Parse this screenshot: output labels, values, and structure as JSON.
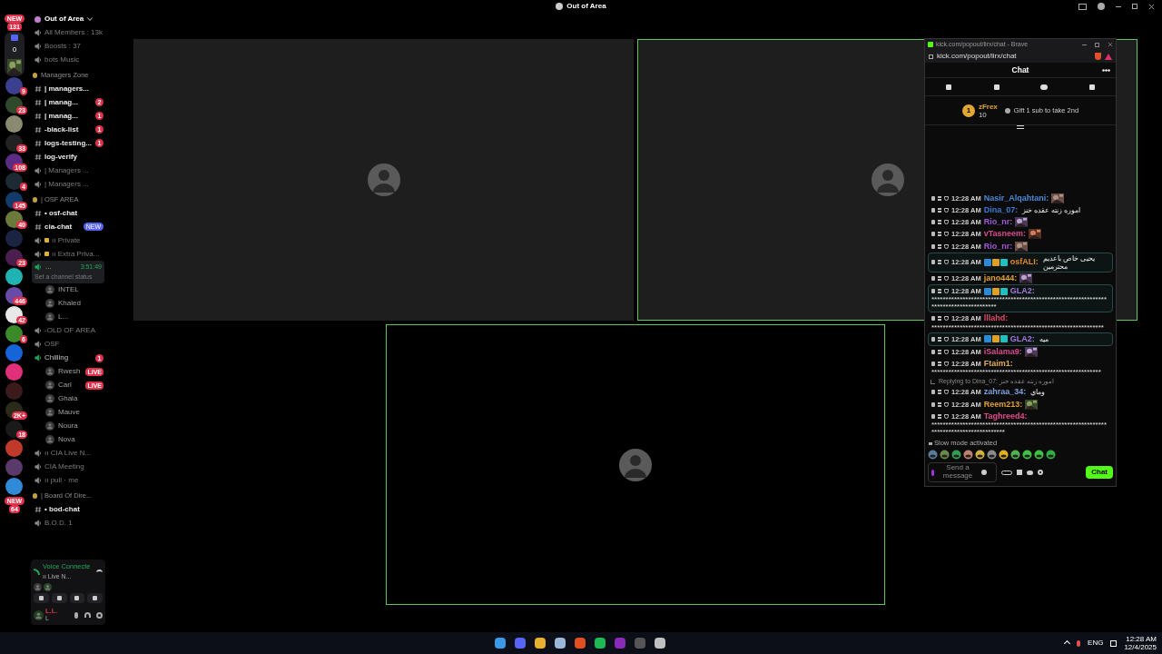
{
  "topbar": {
    "title": "Out of Area"
  },
  "servers": [
    {
      "color": "#3b3f8f",
      "badge": "9"
    },
    {
      "color": "#2f4a2a",
      "badge": "23"
    },
    {
      "color": "#8a8a70"
    },
    {
      "color": "#222222",
      "badge": "33"
    },
    {
      "color": "#5b2c83",
      "badge": "108"
    },
    {
      "color": "#1d2a33",
      "badge": "4"
    },
    {
      "color": "#123a6a",
      "badge": "145"
    },
    {
      "color": "#6b7a3a",
      "badge": "40"
    },
    {
      "color": "#1a2440"
    },
    {
      "color": "#4a1f4f",
      "badge": "23"
    },
    {
      "color": "#1fb3b3"
    },
    {
      "color": "#6a4aa8",
      "badge": "446"
    },
    {
      "color": "#e8e8e8",
      "badge": "42"
    },
    {
      "color": "#3a8a2a",
      "badge": "6"
    },
    {
      "color": "#1565d8"
    },
    {
      "color": "#e0307a"
    },
    {
      "color": "#3a1a1a"
    },
    {
      "color": "#2a2a1a",
      "badge": "2K+"
    },
    {
      "color": "#1a1a1a",
      "badge": "18"
    },
    {
      "color": "#c0392b"
    },
    {
      "color": "#5a3a6a"
    },
    {
      "color": "#2f8ad8"
    }
  ],
  "server_top_badge": {
    "tag": "NEW",
    "count": "131"
  },
  "server_folder": {
    "count": "0"
  },
  "server_bottom_badge": {
    "tag": "NEW",
    "count": "64"
  },
  "server_name": "Out of Area",
  "channels": [
    {
      "kind": "voice",
      "label": "All Members : 13k",
      "unread": false
    },
    {
      "kind": "voice",
      "label": "Boosts : 37",
      "unread": false
    },
    {
      "kind": "voice",
      "label": "bots Music",
      "unread": false
    },
    {
      "kind": "category",
      "label": "Managers Zone"
    },
    {
      "kind": "text",
      "label": "| managers...",
      "unread": true
    },
    {
      "kind": "text",
      "label": "| manag...",
      "unread": true,
      "badge": "2"
    },
    {
      "kind": "text",
      "label": "| manag...",
      "unread": true,
      "badge": "1"
    },
    {
      "kind": "text",
      "label": "-black-list",
      "unread": true,
      "badge": "1"
    },
    {
      "kind": "text",
      "label": "logs-testing...",
      "unread": true,
      "badge": "1"
    },
    {
      "kind": "text",
      "label": "log-verify",
      "unread": true
    },
    {
      "kind": "voice",
      "label": "| Managers ...",
      "unread": false
    },
    {
      "kind": "voice",
      "label": "| Managers ...",
      "unread": false
    },
    {
      "kind": "category",
      "label": "| OSF AREA"
    },
    {
      "kind": "text",
      "label": "• osf-chat",
      "unread": true
    },
    {
      "kind": "text",
      "label": "cia-chat",
      "unread": true,
      "tag": "NEW"
    },
    {
      "kind": "voice",
      "label": "ıı Private",
      "unread": false,
      "locked": true
    },
    {
      "kind": "voice",
      "label": "ıı Extra Priva...",
      "unread": false,
      "locked": true
    },
    {
      "kind": "active",
      "label": "...",
      "time": "3:51:49",
      "status": "Set a channel status"
    },
    {
      "kind": "member",
      "label": "INTEL"
    },
    {
      "kind": "member",
      "label": "Khaled"
    },
    {
      "kind": "member",
      "label": "L..."
    },
    {
      "kind": "voice",
      "label": "-OLD OF AREA",
      "unread": false
    },
    {
      "kind": "voice",
      "label": "OSF",
      "unread": false
    },
    {
      "kind": "voice",
      "label": "Chilling",
      "unread": false,
      "badge": "1",
      "connected": true
    },
    {
      "kind": "member",
      "label": "Rwesh",
      "live": "LIVE"
    },
    {
      "kind": "member",
      "label": "Carl",
      "live": "LIVE"
    },
    {
      "kind": "member",
      "label": "Ghala"
    },
    {
      "kind": "member",
      "label": "Mauve"
    },
    {
      "kind": "member",
      "label": "Noura"
    },
    {
      "kind": "member",
      "label": "Nova"
    },
    {
      "kind": "voice",
      "label": "ıı CIA Live N...",
      "unread": false
    },
    {
      "kind": "voice",
      "label": "CIA Meeting",
      "unread": false
    },
    {
      "kind": "voice",
      "label": "ıı pull · me",
      "unread": false
    },
    {
      "kind": "category",
      "label": "| Board Of Dire..."
    },
    {
      "kind": "text",
      "label": "• bod-chat",
      "unread": true
    },
    {
      "kind": "voice",
      "label": "B.O.D. 1",
      "unread": false
    }
  ],
  "voice_panel": {
    "status": "Voice Connecte",
    "channel": "ıı Live N..."
  },
  "user_panel": {
    "name": "L.L.",
    "sub": "L"
  },
  "chat": {
    "window_title": "kick.com/popout/lirx/chat - Brave",
    "url": "kick.com/popout/lirx/chat",
    "header": "Chat",
    "leader": {
      "rank": "1",
      "name": "zFrex",
      "points": "10",
      "gift": "Gift 1 sub to take 2nd"
    },
    "messages": [
      {
        "time": "12:28 AM",
        "user": "Nasir_Alqahtani:",
        "color": "#4a8ad8",
        "badged": false,
        "highlighted": false,
        "emote": true
      },
      {
        "time": "12:28 AM",
        "user": "Dina_07:",
        "color": "#3a7ad8",
        "badged": false,
        "highlighted": false,
        "emote": false,
        "text": "اموره زنته عقده خنز"
      },
      {
        "time": "12:28 AM",
        "user": "Rio_nr:",
        "color": "#a05ad8",
        "badged": false,
        "highlighted": false,
        "emote": true
      },
      {
        "time": "12:28 AM",
        "user": "vTasneem:",
        "color": "#d84a8a",
        "badged": false,
        "highlighted": false,
        "emote": true
      },
      {
        "time": "12:28 AM",
        "user": "Rio_nr:",
        "color": "#a05ad8",
        "badged": false,
        "highlighted": false,
        "emote": true
      },
      {
        "time": "12:28 AM",
        "user": "osfALI:",
        "color": "#e08a20",
        "badged": true,
        "highlighted": true,
        "emote": false,
        "text": "يحيى خاص باعديم محترمين"
      },
      {
        "time": "12:28 AM",
        "user": "jano444:",
        "color": "#e0a030",
        "badged": false,
        "highlighted": false,
        "emote": true
      },
      {
        "time": "12:28 AM",
        "user": "GLA2:",
        "color": "#a07ae0",
        "badged": true,
        "highlighted": true,
        "emote": false,
        "text": "*************************************************************************************"
      },
      {
        "time": "12:28 AM",
        "user": "lllahd:",
        "color": "#e04a6a",
        "badged": false,
        "highlighted": false,
        "emote": false,
        "text": "*************************************************************"
      },
      {
        "time": "12:28 AM",
        "user": "GLA2:",
        "color": "#a07ae0",
        "badged": true,
        "highlighted": true,
        "emote": false,
        "text": "ميه"
      },
      {
        "time": "12:28 AM",
        "user": "iSalama9:",
        "color": "#d84a8a",
        "badged": false,
        "highlighted": false,
        "emote": true
      },
      {
        "time": "12:28 AM",
        "user": "Ftaim1:",
        "color": "#e0b040",
        "badged": false,
        "highlighted": false,
        "emote": false,
        "text": "************************************************************"
      },
      {
        "time": "12:28 AM",
        "user": "zahraa_34:",
        "color": "#7aa0d8",
        "badged": false,
        "highlighted": false,
        "emote": false,
        "text": "وماي",
        "reply": "Replying to Dina_07: اموره زنته عقده خنز"
      },
      {
        "time": "12:28 AM",
        "user": "Reem213:",
        "color": "#e0a030",
        "badged": false,
        "highlighted": false,
        "emote": true
      },
      {
        "time": "12:28 AM",
        "user": "Taghreed4:",
        "color": "#e04a8a",
        "badged": false,
        "highlighted": false,
        "emote": false,
        "text": "****************************************************************************************"
      }
    ],
    "slow_mode": "Slow mode activated",
    "input": {
      "placeholder": "Send a message"
    },
    "send": "Chat"
  },
  "taskbar": {
    "lang": "ENG",
    "time": "12:28 AM",
    "date": "12/4/2025"
  }
}
